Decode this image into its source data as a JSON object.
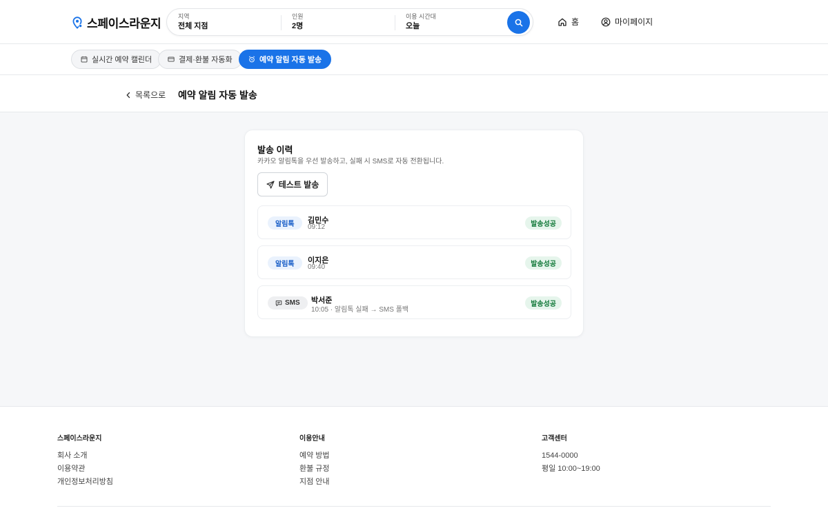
{
  "brand": {
    "name": "스페이스라운지",
    "accent": "#1a73e8"
  },
  "search": {
    "fields": [
      {
        "label": "지역",
        "value": "전체 지점"
      },
      {
        "label": "인원",
        "value": "2명"
      },
      {
        "label": "이용 시간대",
        "value": "오늘"
      }
    ],
    "button_icon": "search-icon"
  },
  "nav": {
    "home": "홈",
    "mypage": "마이페이지"
  },
  "tabs": [
    {
      "label": "실시간 예약 캘린더",
      "icon": "calendar-icon",
      "active": false
    },
    {
      "label": "결제·환불 자동화",
      "icon": "card-icon",
      "active": false
    },
    {
      "label": "예약 알림 자동 발송",
      "icon": "alarm-icon",
      "active": true
    }
  ],
  "titlebar": {
    "back": "목록으로",
    "title": "예약 알림 자동 발송"
  },
  "card": {
    "title": "발송 이력",
    "desc": "카카오 알림톡을 우선 발송하고, 실패 시 SMS로 자동 전환됩니다.",
    "test_button": "테스트 발송",
    "rows": [
      {
        "channel": "알림톡",
        "type": "kakao",
        "name": "김민수",
        "meta": "09:12",
        "status": "발송성공"
      },
      {
        "channel": "알림톡",
        "type": "kakao",
        "name": "이지은",
        "meta": "09:40",
        "status": "발송성공"
      },
      {
        "channel": "SMS",
        "type": "sms",
        "name": "박서준",
        "meta": "10:05 · 알림톡 실패 → SMS 폴백",
        "status": "발송성공"
      }
    ]
  },
  "footer": {
    "col1": {
      "heading": "스페이스라운지",
      "items": [
        "회사 소개",
        "이용약관",
        "개인정보처리방침"
      ]
    },
    "col2": {
      "heading": "이용안내",
      "items": [
        "예약 방법",
        "환불 규정",
        "지점 안내"
      ]
    },
    "col3": {
      "heading": "고객센터",
      "items": [
        "1544-0000",
        "평일 10:00~19:00"
      ]
    }
  }
}
